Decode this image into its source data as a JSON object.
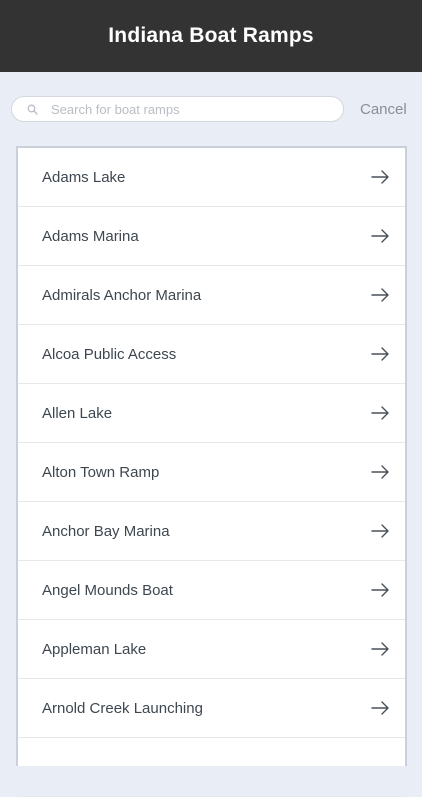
{
  "header": {
    "title": "Indiana Boat Ramps"
  },
  "search": {
    "placeholder": "Search for boat ramps",
    "value": "",
    "icon": "search-icon"
  },
  "cancel_label": "Cancel",
  "colors": {
    "header_bg": "#333333",
    "page_bg": "#e9eef6",
    "list_bg": "#ffffff",
    "text": "#3e4750"
  },
  "list": {
    "items": [
      {
        "label": "Adams Lake"
      },
      {
        "label": "Adams Marina"
      },
      {
        "label": "Admirals Anchor Marina"
      },
      {
        "label": "Alcoa Public Access"
      },
      {
        "label": "Allen Lake"
      },
      {
        "label": "Alton Town Ramp"
      },
      {
        "label": "Anchor Bay Marina"
      },
      {
        "label": "Angel Mounds Boat"
      },
      {
        "label": "Appleman Lake"
      },
      {
        "label": "Arnold Creek Launching"
      },
      {
        "label": ""
      }
    ],
    "item_icon": "arrow-right-icon"
  }
}
